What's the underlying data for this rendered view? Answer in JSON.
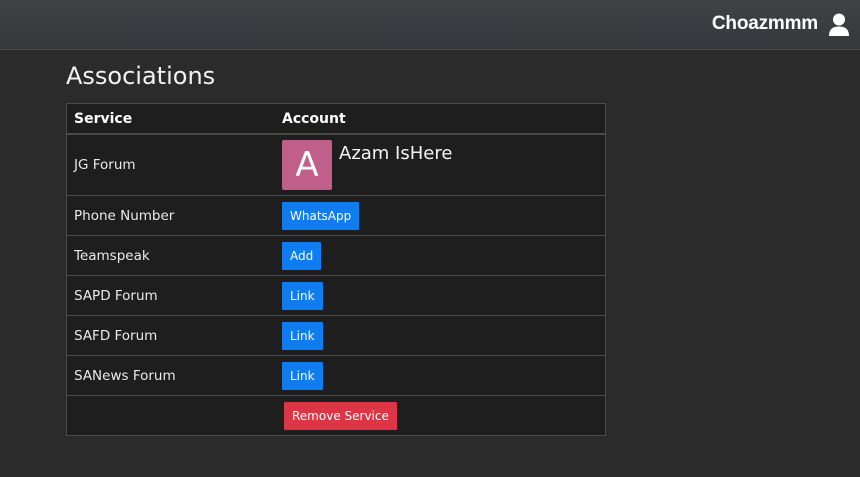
{
  "header": {
    "username": "Choazmmm",
    "user_icon": "user-icon"
  },
  "page": {
    "title": "Associations"
  },
  "table": {
    "headers": {
      "service": "Service",
      "account": "Account"
    },
    "rows": [
      {
        "service": "JG Forum",
        "account_type": "profile",
        "avatar_letter": "A",
        "account_name": "Azam IsHere",
        "avatar_color": "#c0608a"
      },
      {
        "service": "Phone Number",
        "account_type": "button",
        "button_label": "WhatsApp"
      },
      {
        "service": "Teamspeak",
        "account_type": "button",
        "button_label": "Add"
      },
      {
        "service": "SAPD Forum",
        "account_type": "button",
        "button_label": "Link"
      },
      {
        "service": "SAFD Forum",
        "account_type": "button",
        "button_label": "Link"
      },
      {
        "service": "SANews Forum",
        "account_type": "button",
        "button_label": "Link"
      }
    ],
    "remove_label": "Remove Service"
  },
  "colors": {
    "primary_button": "#0f7cf0",
    "danger_button": "#dc3545",
    "background": "#2b2b2b"
  }
}
